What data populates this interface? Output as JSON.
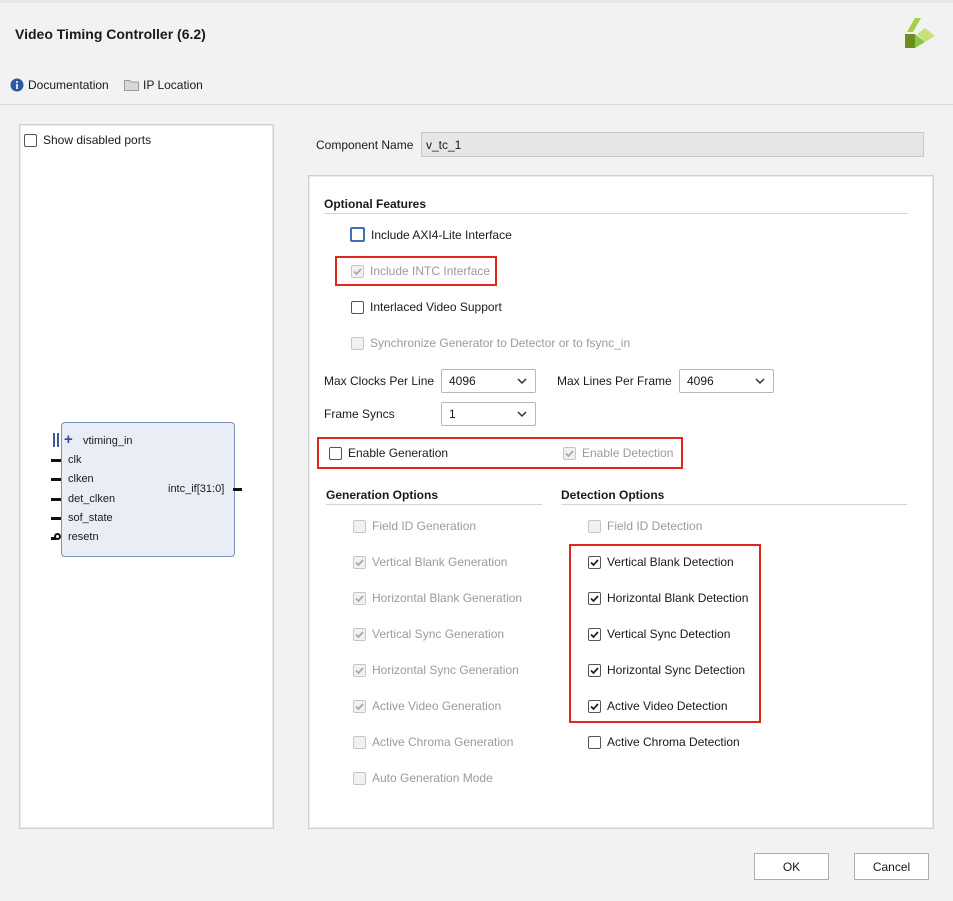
{
  "window": {
    "title": "Video Timing Controller (6.2)"
  },
  "toolbar": {
    "documentation": "Documentation",
    "ip_location": "IP Location"
  },
  "left_panel": {
    "show_disabled_ports": "Show disabled ports",
    "block": {
      "input_bus": "vtiming_in",
      "inputs": [
        "clk",
        "clken",
        "det_clken",
        "sof_state",
        "resetn"
      ],
      "output": "intc_if[31:0]"
    }
  },
  "component": {
    "label": "Component Name",
    "value": "v_tc_1"
  },
  "optional_features": {
    "title": "Optional Features",
    "axi4_lite": "Include AXI4-Lite Interface",
    "intc": "Include INTC Interface",
    "interlaced": "Interlaced Video Support",
    "sync": "Synchronize Generator to Detector or to fsync_in"
  },
  "params": {
    "max_clocks_label": "Max Clocks Per Line",
    "max_clocks_value": "4096",
    "max_lines_label": "Max Lines Per Frame",
    "max_lines_value": "4096",
    "frame_syncs_label": "Frame Syncs",
    "frame_syncs_value": "1"
  },
  "enable": {
    "generation": "Enable Generation",
    "detection": "Enable Detection"
  },
  "generation_options": {
    "title": "Generation Options",
    "items": [
      "Field ID Generation",
      "Vertical Blank Generation",
      "Horizontal Blank Generation",
      "Vertical Sync Generation",
      "Horizontal Sync Generation",
      "Active Video Generation",
      "Active Chroma Generation",
      "Auto Generation Mode"
    ]
  },
  "detection_options": {
    "title": "Detection Options",
    "items": [
      "Field ID Detection",
      "Vertical Blank Detection",
      "Horizontal Blank Detection",
      "Vertical Sync Detection",
      "Horizontal Sync Detection",
      "Active Video Detection",
      "Active Chroma Detection"
    ]
  },
  "buttons": {
    "ok": "OK",
    "cancel": "Cancel"
  },
  "colors": {
    "highlight_red": "#e1261c",
    "focus_blue": "#3e6fc2",
    "logo_green": "#8cc63f"
  }
}
